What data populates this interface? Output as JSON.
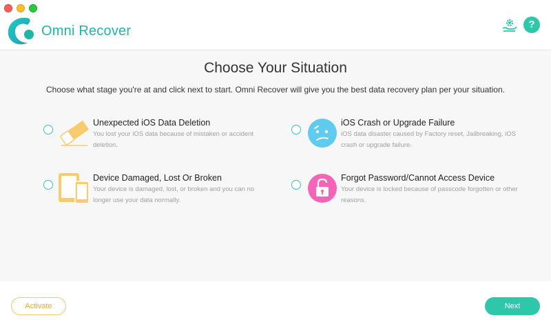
{
  "app": {
    "name": "Omni Recover"
  },
  "header": {
    "help_label": "?"
  },
  "main": {
    "title": "Choose Your Situation",
    "subtitle": "Choose what stage you're at and click next to start. Omni Recover will give you the best data recovery plan per your situation.",
    "options": [
      {
        "title": "Unexpected iOS Data Deletion",
        "description": "You lost your iOS data because of mistaken or accident deletion.",
        "icon": "eraser-icon"
      },
      {
        "title": "iOS Crash or Upgrade Failure",
        "description": "iOS data disaster caused by Factory reset, Jailbreaking, iOS crash or upgrade failure.",
        "icon": "confused-face-icon"
      },
      {
        "title": "Device Damaged, Lost Or Broken",
        "description": "Your device is damaged, lost, or broken and you can no longer use your data normally.",
        "icon": "devices-icon"
      },
      {
        "title": "Forgot Password/Cannot Access Device",
        "description": "Your device is locked because of passcode forgotten or other reasons.",
        "icon": "padlock-icon"
      }
    ]
  },
  "footer": {
    "activate_label": "Activate",
    "next_label": "Next"
  },
  "colors": {
    "accent": "#2ec7a9",
    "activate": "#f0a830",
    "eraser": "#f8cc6e",
    "face": "#5fcbee",
    "lock": "#f564b6"
  }
}
